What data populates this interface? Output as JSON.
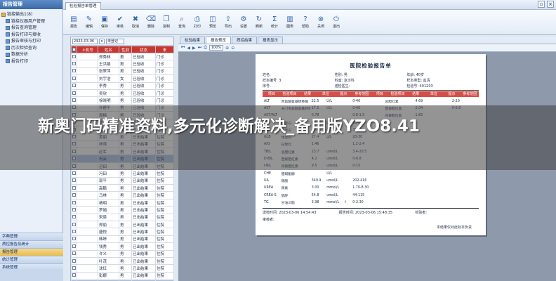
{
  "sidebar": {
    "title": "报告管理",
    "tree": [
      {
        "label": "链接输出1(8)",
        "level": 0
      },
      {
        "label": "链接仪器用户管理",
        "level": 1
      },
      {
        "label": "报告查询管理",
        "level": 1
      },
      {
        "label": "报告打印与接收",
        "level": 1
      },
      {
        "label": "报告审核与打印",
        "level": 1
      },
      {
        "label": "历次检验查询",
        "level": 1
      },
      {
        "label": "数据分析",
        "level": 1
      },
      {
        "label": "报告打印",
        "level": 1
      }
    ],
    "sections": [
      "字典管理",
      "质控报告及统计",
      "报告管理",
      "统计管理",
      "系统管理"
    ],
    "selected_section": "报告管理"
  },
  "window": {
    "title": "检验报告单管理"
  },
  "toolbar": [
    {
      "label": "报告",
      "icon": "report-icon"
    },
    {
      "label": "编辑",
      "icon": "edit-icon"
    },
    {
      "label": "保存",
      "icon": "save-icon"
    },
    {
      "label": "审核",
      "icon": "check-icon"
    },
    {
      "label": "取消",
      "icon": "cancel-icon"
    },
    {
      "label": "删除",
      "icon": "delete-icon"
    },
    {
      "label": "复制",
      "icon": "copy-icon"
    },
    {
      "label": "查询",
      "icon": "search-icon"
    },
    {
      "label": "打印",
      "icon": "print-icon"
    },
    {
      "label": "预览",
      "icon": "preview-icon"
    },
    {
      "label": "导出",
      "icon": "export-icon"
    },
    {
      "label": "设置",
      "icon": "settings-icon"
    },
    {
      "label": "刷新",
      "icon": "refresh-icon"
    },
    {
      "label": "统计",
      "icon": "stats-icon"
    },
    {
      "label": "图表",
      "icon": "chart-icon"
    },
    {
      "label": "帮助",
      "icon": "help-icon"
    },
    {
      "label": "关闭",
      "icon": "close-icon"
    },
    {
      "label": "退出",
      "icon": "exit-icon"
    }
  ],
  "list": {
    "date": "2023-03-06",
    "type_filter": "未登记",
    "columns": [
      "上机号",
      "姓名",
      "性别",
      "状态",
      "来"
    ],
    "rows": [
      [
        "",
        "郑秀林",
        "男",
        "已验收",
        "门诊"
      ],
      [
        "",
        "王洪娟",
        "男",
        "已验收",
        "门诊"
      ],
      [
        "",
        "张翠萍",
        "男",
        "已验收",
        "门诊"
      ],
      [
        "",
        "刘宇浩",
        "女",
        "已验收",
        "门诊"
      ],
      [
        "",
        "李秀",
        "男",
        "已验收",
        "门诊"
      ],
      [
        "",
        "吴欣",
        "男",
        "已验收",
        "门诊"
      ],
      [
        "",
        "徐晓明",
        "男",
        "已验收",
        "门诊"
      ],
      [
        "",
        "孙建平",
        "男",
        "已验收",
        "门诊"
      ],
      [
        "",
        "周梅",
        "男",
        "已验收",
        "门诊"
      ],
      [
        "",
        "陈志强",
        "女",
        "已验收",
        "门诊"
      ],
      [
        "",
        "张华",
        "男",
        "已验收",
        "门诊"
      ],
      [
        "",
        "黄丽",
        "男",
        "已出结果",
        "住院"
      ],
      [
        "",
        "林涛",
        "男",
        "已出结果",
        "住院"
      ],
      [
        "",
        "赵军",
        "男",
        "已出结果",
        "住院"
      ],
      [
        "",
        "何云",
        "男",
        "已出结果",
        "住院"
      ],
      [
        "",
        "吕田",
        "男",
        "已出结果",
        "住院"
      ],
      [
        "",
        "冯田",
        "男",
        "已出结果",
        "住院"
      ],
      [
        "",
        "郭平",
        "男",
        "已出结果",
        "住院"
      ],
      [
        "",
        "高鹏",
        "男",
        "已出结果",
        "住院"
      ],
      [
        "",
        "马林",
        "男",
        "已出结果",
        "住院"
      ],
      [
        "",
        "杨明",
        "男",
        "已出结果",
        "住院"
      ],
      [
        "",
        "罗娟",
        "男",
        "已出结果",
        "住院"
      ],
      [
        "",
        "宋梁",
        "男",
        "已出结果",
        "住院"
      ],
      [
        "",
        "郑丽",
        "男",
        "已出结果",
        "住院"
      ],
      [
        "",
        "唐悦",
        "男",
        "已出结果",
        "住院"
      ],
      [
        "",
        "韩婷",
        "男",
        "已出结果",
        "住院"
      ],
      [
        "",
        "钱秀",
        "男",
        "已出结果",
        "住院"
      ],
      [
        "",
        "许义",
        "男",
        "已出结果",
        "住院"
      ],
      [
        "",
        "叶茂",
        "男",
        "已出结果",
        "住院"
      ],
      [
        "",
        "沈红",
        "男",
        "已出结果",
        "住院"
      ],
      [
        "",
        "彭娜",
        "男",
        "已出结果",
        "住院"
      ],
      [
        "",
        "雷青",
        "男",
        "已出结果",
        "住院"
      ]
    ],
    "selected_row": 14
  },
  "tabs": [
    "检验结果",
    "报告预览",
    "质控结果",
    "报表显示"
  ],
  "active_tab": "报告预览",
  "viewer": {
    "zoom": "100%"
  },
  "report": {
    "title": "医院检验报告单",
    "meta": [
      [
        "姓名:",
        "",
        "性别: 男",
        "年龄: 40岁",
        "样本类型: 血清"
      ],
      [
        "病人号: 3",
        "",
        "床号:",
        "科室: 急诊科",
        "检验号: 401203"
      ]
    ],
    "meta_flat": [
      "姓名:",
      "性别: 男",
      "年龄: 40岁",
      "样本编号: 3",
      "科室: 急诊科",
      "样本类型: 血清",
      "床号:",
      "送检医生:",
      "检验号: 401203"
    ],
    "headers": [
      "项目",
      "检验项目",
      "结果",
      "单位",
      "提示",
      "参考范围",
      "项目",
      "检验项目",
      "结果",
      "单位",
      "提示",
      "参考范围"
    ],
    "rows": [
      [
        "ALT",
        "丙氨酸氨基转移酶",
        "22.5",
        "U/L",
        "",
        "0-40",
        "",
        "总胆红素",
        "4.69",
        "",
        "",
        "2-20"
      ],
      [
        "AST",
        "天门冬氨酸氨基转移酶",
        "17.5",
        "U/L",
        "",
        "0-40",
        "",
        "直接胆红素",
        "2.04",
        "",
        "",
        "0-6.8"
      ],
      [
        "AST/ALT",
        "",
        "0.78",
        "",
        "",
        "0.8-1.5",
        "",
        "间接胆红素",
        "1.65",
        "",
        "",
        ""
      ],
      [
        "TP",
        "总蛋白",
        "67.4",
        "g/L",
        "",
        "60-80",
        "",
        "",
        "",
        "",
        "",
        ""
      ],
      [
        "ALB",
        "白蛋白",
        "40.0",
        "g/L",
        "",
        "35-55",
        "",
        "",
        "",
        "",
        "",
        ""
      ],
      [
        "GLB",
        "球蛋白",
        "27.4",
        "g/L",
        "",
        "20-30",
        "",
        "",
        "",
        "",
        "",
        ""
      ],
      [
        "A/G",
        "白球比",
        "1.46",
        "",
        "",
        "1.2-2.4",
        "",
        "",
        "",
        "",
        "",
        ""
      ],
      [
        "TBIL",
        "总胆红素",
        "13.7",
        "umol/L",
        "",
        "3.4-20.5",
        "",
        "",
        "",
        "",
        "",
        ""
      ],
      [
        "D-BIL",
        "直接胆红素",
        "4.2",
        "umol/L",
        "",
        "0-6.8",
        "",
        "",
        "",
        "",
        "",
        ""
      ],
      [
        "I-BIL",
        "间接胆红素",
        "9.5",
        "umol/L",
        "",
        "0-15",
        "",
        "",
        "",
        "",
        "",
        ""
      ],
      [
        "CHE",
        "胆碱酯酶",
        "",
        "U/L",
        "",
        "",
        "",
        "",
        "",
        "",
        "",
        ""
      ],
      [
        "UA",
        "尿酸",
        "349.9",
        "umol/L",
        "",
        "202-416",
        "",
        "",
        "",
        "",
        "",
        ""
      ],
      [
        "UREA",
        "尿素",
        "3.00",
        "mmol/L",
        "",
        "1.70-8.30",
        "",
        "",
        "",
        "",
        "",
        ""
      ],
      [
        "CREA-S",
        "肌酐",
        "54.8",
        "umol/L",
        "",
        "44-115",
        "",
        "",
        "",
        "",
        "",
        ""
      ],
      [
        "TG",
        "甘油三酯",
        "3.98",
        "mmol/L",
        "↑",
        "0-2.30",
        "",
        "",
        "",
        "",
        "",
        ""
      ]
    ],
    "footer": {
      "send_time": "送检时间: 2023-03-06 14:54:43",
      "report_time": "报告时间: 2023-03-06 15:48:35",
      "tester": "检验者:",
      "reviewer": "审核者:",
      "note": "本结果仅对此标本负责"
    }
  },
  "banner": {
    "text": "新奥门码精准资料,多元化诊断解决_备用版YZO8.41"
  }
}
